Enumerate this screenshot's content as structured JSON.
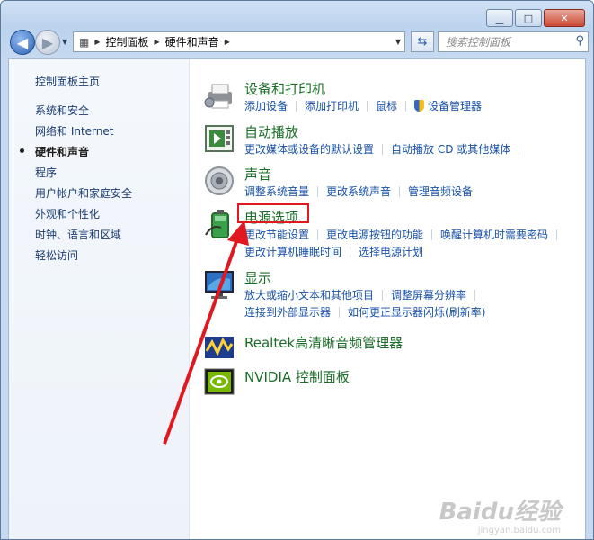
{
  "window": {
    "minimize_icon": "minimize-icon",
    "maximize_icon": "maximize-icon",
    "close_label": "✕"
  },
  "nav": {
    "breadcrumbs": [
      "控制面板",
      "硬件和声音"
    ],
    "search_placeholder": "搜索控制面板"
  },
  "sidebar": {
    "items": [
      {
        "label": "控制面板主页",
        "current": false
      },
      {
        "label": "系统和安全",
        "current": false
      },
      {
        "label": "网络和 Internet",
        "current": false
      },
      {
        "label": "硬件和声音",
        "current": true
      },
      {
        "label": "程序",
        "current": false
      },
      {
        "label": "用户帐户和家庭安全",
        "current": false
      },
      {
        "label": "外观和个性化",
        "current": false
      },
      {
        "label": "时钟、语言和区域",
        "current": false
      },
      {
        "label": "轻松访问",
        "current": false
      }
    ]
  },
  "categories": [
    {
      "title": "设备和打印机",
      "icon": "printer-icon",
      "links": [
        [
          "添加设备",
          "添加打印机",
          "鼠标",
          "设备管理器"
        ]
      ]
    },
    {
      "title": "自动播放",
      "icon": "autoplay-icon",
      "links": [
        [
          "更改媒体或设备的默认设置",
          "自动播放 CD 或其他媒体"
        ]
      ]
    },
    {
      "title": "声音",
      "icon": "speaker-icon",
      "links": [
        [
          "调整系统音量",
          "更改系统声音",
          "管理音频设备"
        ]
      ]
    },
    {
      "title": "电源选项",
      "icon": "battery-icon",
      "links": [
        [
          "更改节能设置",
          "更改电源按钮的功能",
          "唤醒计算机时需要密码"
        ],
        [
          "更改计算机睡眠时间",
          "选择电源计划"
        ]
      ]
    },
    {
      "title": "显示",
      "icon": "monitor-icon",
      "links": [
        [
          "放大或缩小文本和其他项目",
          "调整屏幕分辨率"
        ],
        [
          "连接到外部显示器",
          "如何更正显示器闪烁(刷新率)"
        ]
      ]
    },
    {
      "title": "Realtek高清晰音频管理器",
      "icon": "realtek-audio-icon",
      "links": []
    },
    {
      "title": "NVIDIA 控制面板",
      "icon": "nvidia-icon",
      "links": []
    }
  ],
  "watermark": {
    "brand": "Baidu经验",
    "url": "jingyan.baidu.com"
  },
  "colors": {
    "link": "#1750a6",
    "title": "#1b6e28",
    "highlight": "#e0181f"
  }
}
